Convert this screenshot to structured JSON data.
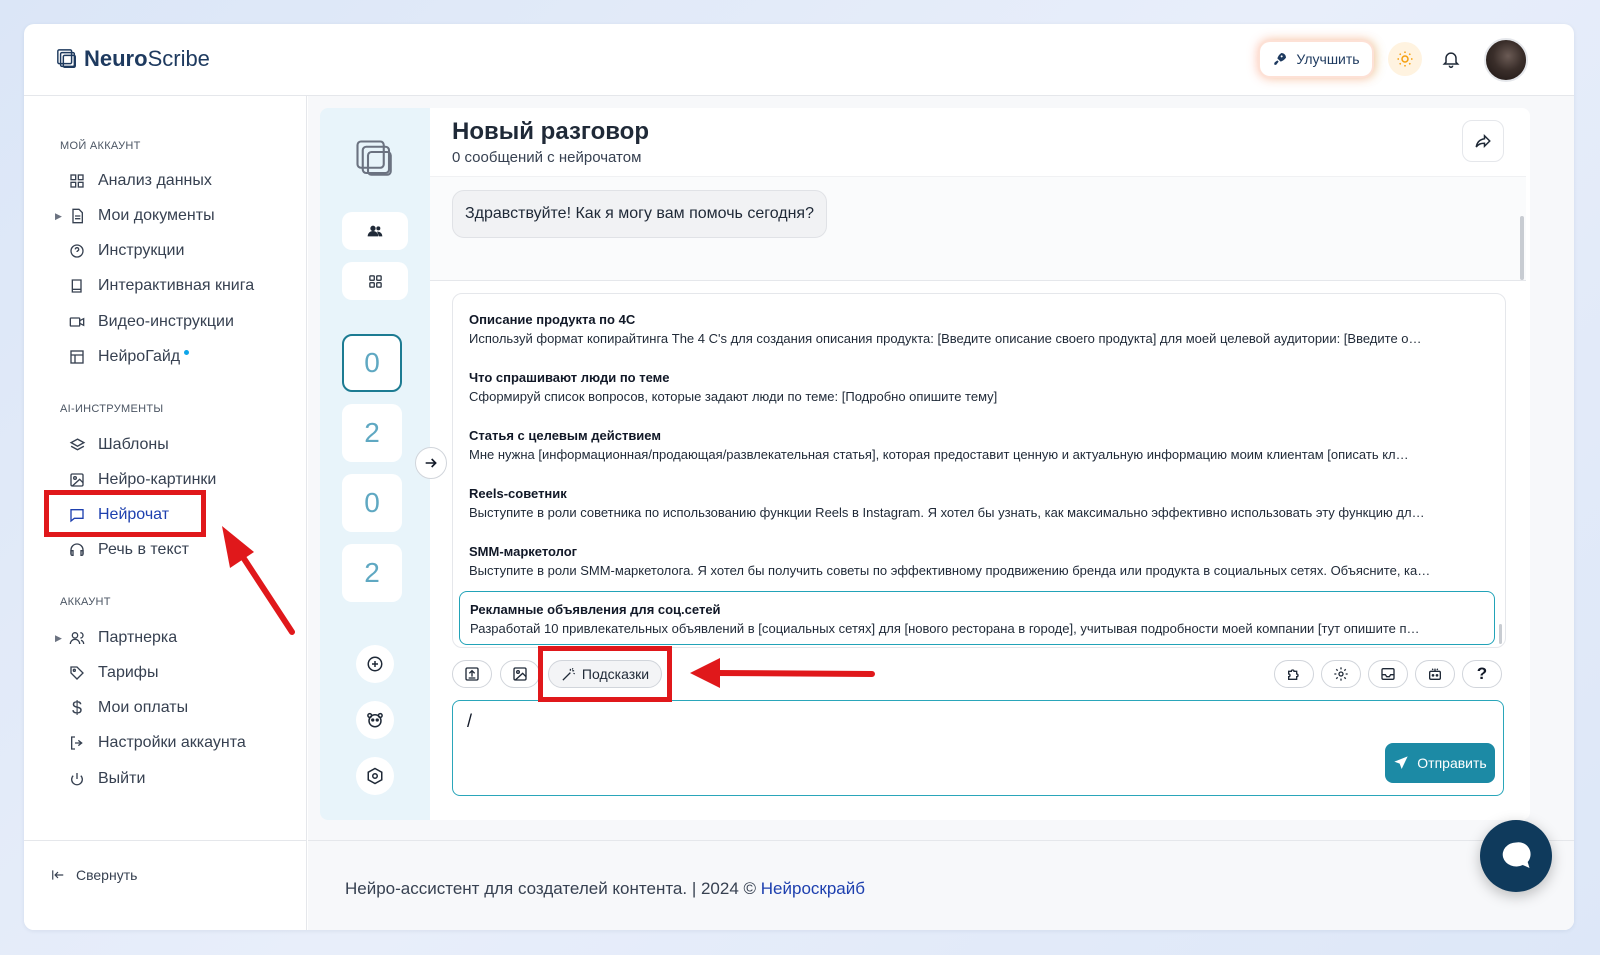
{
  "brand": {
    "name_bold": "Neuro",
    "name_rest": "Scribe"
  },
  "header": {
    "upgrade_label": "Улучшить"
  },
  "sidebar": {
    "section_account": "МОЙ АККАУНТ",
    "account_items": [
      {
        "label": "Анализ данных",
        "icon": "grid-icon"
      },
      {
        "label": "Мои документы",
        "icon": "document-icon"
      },
      {
        "label": "Инструкции",
        "icon": "help-circle-icon"
      },
      {
        "label": "Интерактивная книга",
        "icon": "book-icon"
      },
      {
        "label": "Видео-инструкции",
        "icon": "video-icon"
      },
      {
        "label": "НейроГайд",
        "icon": "table-icon"
      }
    ],
    "section_tools": "AI-ИНСТРУМЕНТЫ",
    "tool_items": [
      {
        "label": "Шаблоны",
        "icon": "layers-icon"
      },
      {
        "label": "Нейро-картинки",
        "icon": "image-icon"
      },
      {
        "label": "Нейрочат",
        "icon": "chat-icon"
      },
      {
        "label": "Речь в текст",
        "icon": "headphones-icon"
      }
    ],
    "section_profile": "АККАУНТ",
    "profile_items": [
      {
        "label": "Партнерка",
        "icon": "users-icon"
      },
      {
        "label": "Тарифы",
        "icon": "tag-icon"
      },
      {
        "label": "Мои оплаты",
        "icon": "dollar-icon"
      },
      {
        "label": "Настройки аккаунта",
        "icon": "logout-icon"
      },
      {
        "label": "Выйти",
        "icon": "power-icon"
      }
    ],
    "collapse_label": "Свернуть"
  },
  "rail": {
    "counters": [
      "0",
      "2",
      "0",
      "2"
    ]
  },
  "chat": {
    "title": "Новый разговор",
    "subtitle": "0 сообщений с нейрочатом",
    "greeting": "Здравствуйте! Как я могу вам помочь сегодня?",
    "prompts": [
      {
        "title": "Описание продукта по 4С",
        "desc": "Используй формат копирайтинга The 4 C's для создания описания продукта: [Введите описание своего продукта] для моей целевой аудитории: [Введите о…"
      },
      {
        "title": "Что спрашивают люди по теме",
        "desc": "Сформируй список вопросов, которые задают люди по теме: [Подробно опишите тему]"
      },
      {
        "title": "Статья с целевым действием",
        "desc": "Мне нужна [информационная/продающая/развлекательная статья], которая предоставит ценную и актуальную информацию моим клиентам [описать кл…"
      },
      {
        "title": "Reels-советник",
        "desc": "Выступите в роли советника по использованию функции Reels в Instagram. Я хотел бы узнать, как максимально эффективно использовать эту функцию дл…"
      },
      {
        "title": "SMM-маркетолог",
        "desc": "Выступите в роли SMM-маркетолога. Я хотел бы получить советы по эффективному продвижению бренда или продукта в социальных сетях. Объясните, ка…"
      },
      {
        "title": "Рекламные объявления для соц.сетей",
        "desc": "Разработай 10 привлекательных объявлений в [социальных сетях] для [нового ресторана в городе], учитывая подробности моей компании [тут опишите п…"
      }
    ],
    "hints_label": "Подсказки",
    "input_value": "/",
    "send_label": "Отправить"
  },
  "footer": {
    "text": "Нейро-ассистент для создателей контента.  | 2024 © ",
    "link": "Нейроскрайб"
  },
  "colors": {
    "accent": "#1c8aa5",
    "annotation": "#e0181b",
    "brand_dark": "#1e3a5f"
  }
}
